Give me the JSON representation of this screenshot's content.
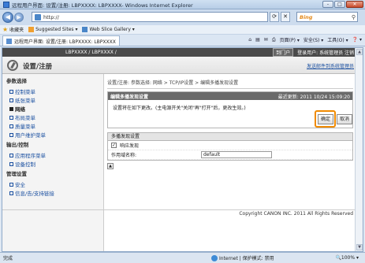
{
  "window": {
    "title": "远程用户界面: 设置/注册: LBPXXXX: LBPXXXX- Windows Internet Explorer",
    "min": "-",
    "max": "□",
    "close": "✕"
  },
  "address": {
    "url": "http://",
    "search_engine": "Bing",
    "refresh": "⟳",
    "stop": "✕"
  },
  "favorites": {
    "label": "收藏夹",
    "suggested": "Suggested Sites ▾",
    "webslice": "Web Slice Gallery ▾"
  },
  "tab": {
    "label": "远程用户界面: 设置/注册: LBPXXXX: LBPXXXX"
  },
  "commands": {
    "page": "页面(P) ▾",
    "safety": "安全(S) ▾",
    "tools": "工具(O) ▾",
    "help": "❓ ▾"
  },
  "app": {
    "model": "LBPXXXX / LBPXXXX /",
    "logout": "注销",
    "login_user": "登录用户: 系统管理员 注销",
    "title": "设置/注册",
    "mail_link": "发送邮件到系统管理员"
  },
  "sidebar": {
    "sections": [
      {
        "label": "参数选择",
        "items": [
          {
            "label": "控制菜单",
            "active": false
          },
          {
            "label": "纸张菜单",
            "active": false
          },
          {
            "label": "网络",
            "active": true
          },
          {
            "label": "布局菜单",
            "active": false
          },
          {
            "label": "质量菜单",
            "active": false
          },
          {
            "label": "用户维护菜单",
            "active": false
          }
        ]
      },
      {
        "label": "输出/控制",
        "items": [
          {
            "label": "应用程序菜单",
            "active": false
          },
          {
            "label": "设备控制",
            "active": false
          }
        ]
      },
      {
        "label": "管理设置",
        "items": [
          {
            "label": "安全",
            "active": false
          },
          {
            "label": "信息/告/支持链接",
            "active": false
          }
        ]
      }
    ]
  },
  "main": {
    "breadcrumb": "设置/注册: 参数选择: 网络 > TCP/IP设置 > 编辑多播发现设置",
    "panel_title": "编辑多播发现设置",
    "last_updated": "最近更新: 2011 10/24 15:09:20",
    "message": "设置将在如下更改。(主电源开关\"关闭\"再\"打开\"后，更改生效。)",
    "ok": "确定",
    "cancel": "取消",
    "section_title": "多播发现设置",
    "respond_label": "响应发现",
    "respond_checked": "✓",
    "scope_label": "作用域名称:",
    "scope_value": "default",
    "to_top": "▲"
  },
  "footer": {
    "copyright": "Copyright CANON INC. 2011 All Rights Reserved"
  },
  "status": {
    "text": "完成",
    "zone": "Internet | 保护模式: 禁用",
    "zoom": "🔍100% ▾"
  }
}
